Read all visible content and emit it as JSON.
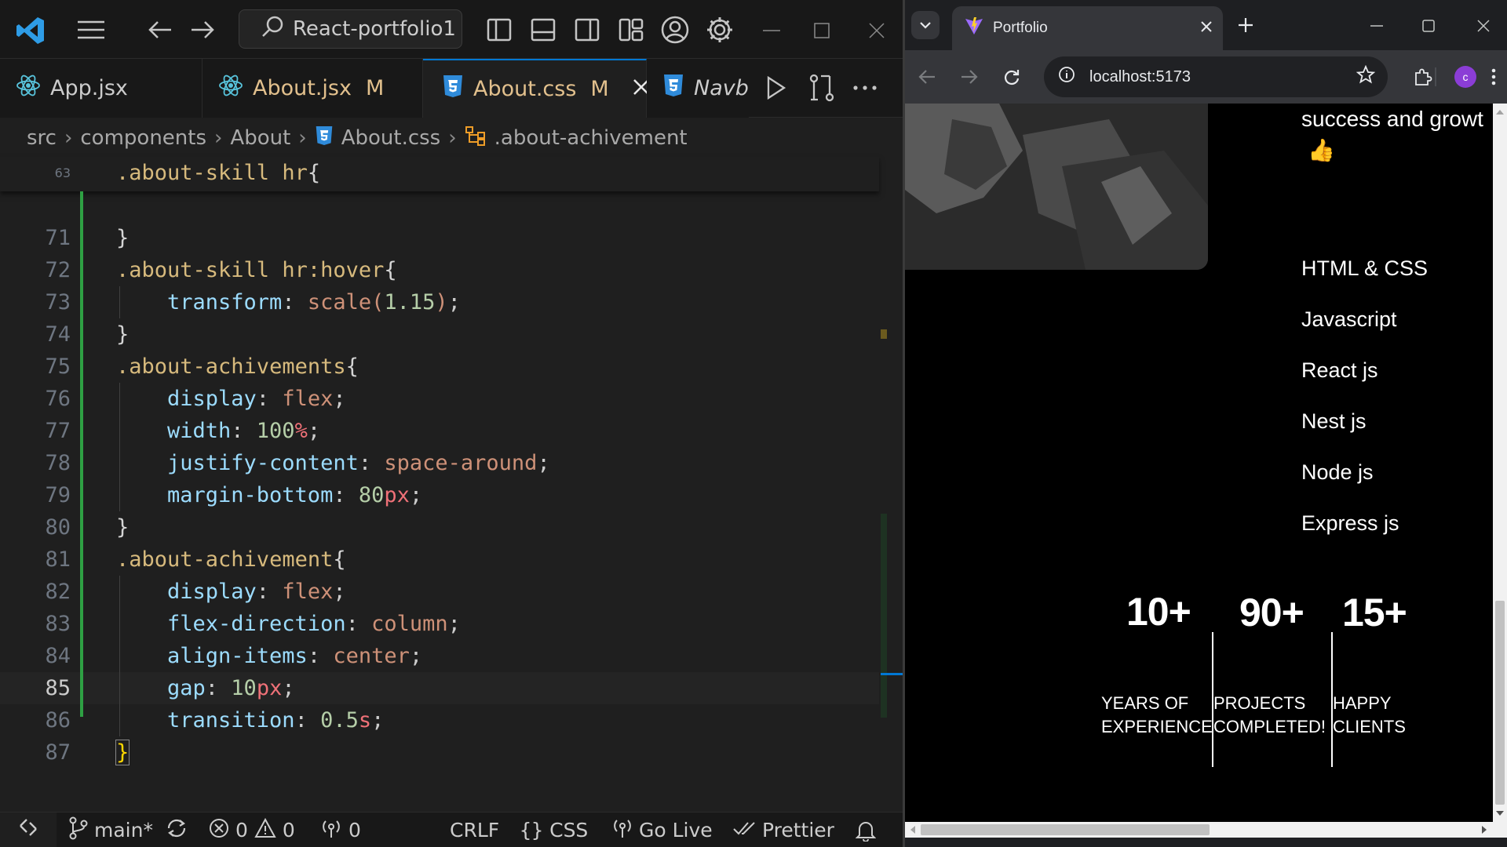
{
  "vscode": {
    "search": "React-portfolio1",
    "tabs": [
      {
        "label": "App.jsx",
        "modified": ""
      },
      {
        "label": "About.jsx",
        "modified": "M"
      },
      {
        "label": "About.css",
        "modified": "M"
      },
      {
        "label": "Navb",
        "modified": ""
      }
    ],
    "breadcrumb": [
      "src",
      "components",
      "About",
      "About.css",
      ".about-achivement"
    ],
    "sticky_line": {
      "num": "63",
      "code": ".about-skill hr{"
    },
    "lines": [
      {
        "num": "71",
        "code": "}"
      },
      {
        "num": "72",
        "code": ".about-skill hr:hover{"
      },
      {
        "num": "73",
        "code": "transform: scale(1.15);"
      },
      {
        "num": "74",
        "code": "}"
      },
      {
        "num": "75",
        "code": ".about-achivements{"
      },
      {
        "num": "76",
        "code": "display: flex;"
      },
      {
        "num": "77",
        "code": "width: 100%;"
      },
      {
        "num": "78",
        "code": "justify-content: space-around;"
      },
      {
        "num": "79",
        "code": "margin-bottom: 80px;"
      },
      {
        "num": "80",
        "code": "}"
      },
      {
        "num": "81",
        "code": ".about-achivement{"
      },
      {
        "num": "82",
        "code": "display: flex;"
      },
      {
        "num": "83",
        "code": "flex-direction: column;"
      },
      {
        "num": "84",
        "code": "align-items: center;"
      },
      {
        "num": "85",
        "code": "gap: 10px;"
      },
      {
        "num": "86",
        "code": "transition: 0.5s;"
      },
      {
        "num": "87",
        "code": "}"
      }
    ],
    "current_line": "85",
    "status": {
      "branch": "main*",
      "errors": "0",
      "warnings": "0",
      "ports": "0",
      "eol": "CRLF",
      "language": "CSS",
      "golive": "Go Live",
      "prettier": "Prettier"
    }
  },
  "browser": {
    "tab_title": "Portfolio",
    "url": "localhost:5173",
    "profile_initial": "c",
    "page": {
      "intro_line": "success and growt",
      "emoji": "👍",
      "skills": [
        "HTML & CSS",
        "Javascript",
        "React js",
        "Nest js",
        "Node js",
        "Express js"
      ],
      "achievements": [
        {
          "num": "10+",
          "line1": "YEARS OF",
          "line2": "EXPERIENCE"
        },
        {
          "num": "90+",
          "line1": "PROJECTS",
          "line2": "COMPLETED!"
        },
        {
          "num": "15+",
          "line1": "HAPPY",
          "line2": "CLIENTS"
        }
      ]
    }
  },
  "colors": {
    "vscode_accent": "#0078d4",
    "modified": "#e2c08d",
    "gutter_added": "#2ea043",
    "profile": "#8b3dd6"
  }
}
